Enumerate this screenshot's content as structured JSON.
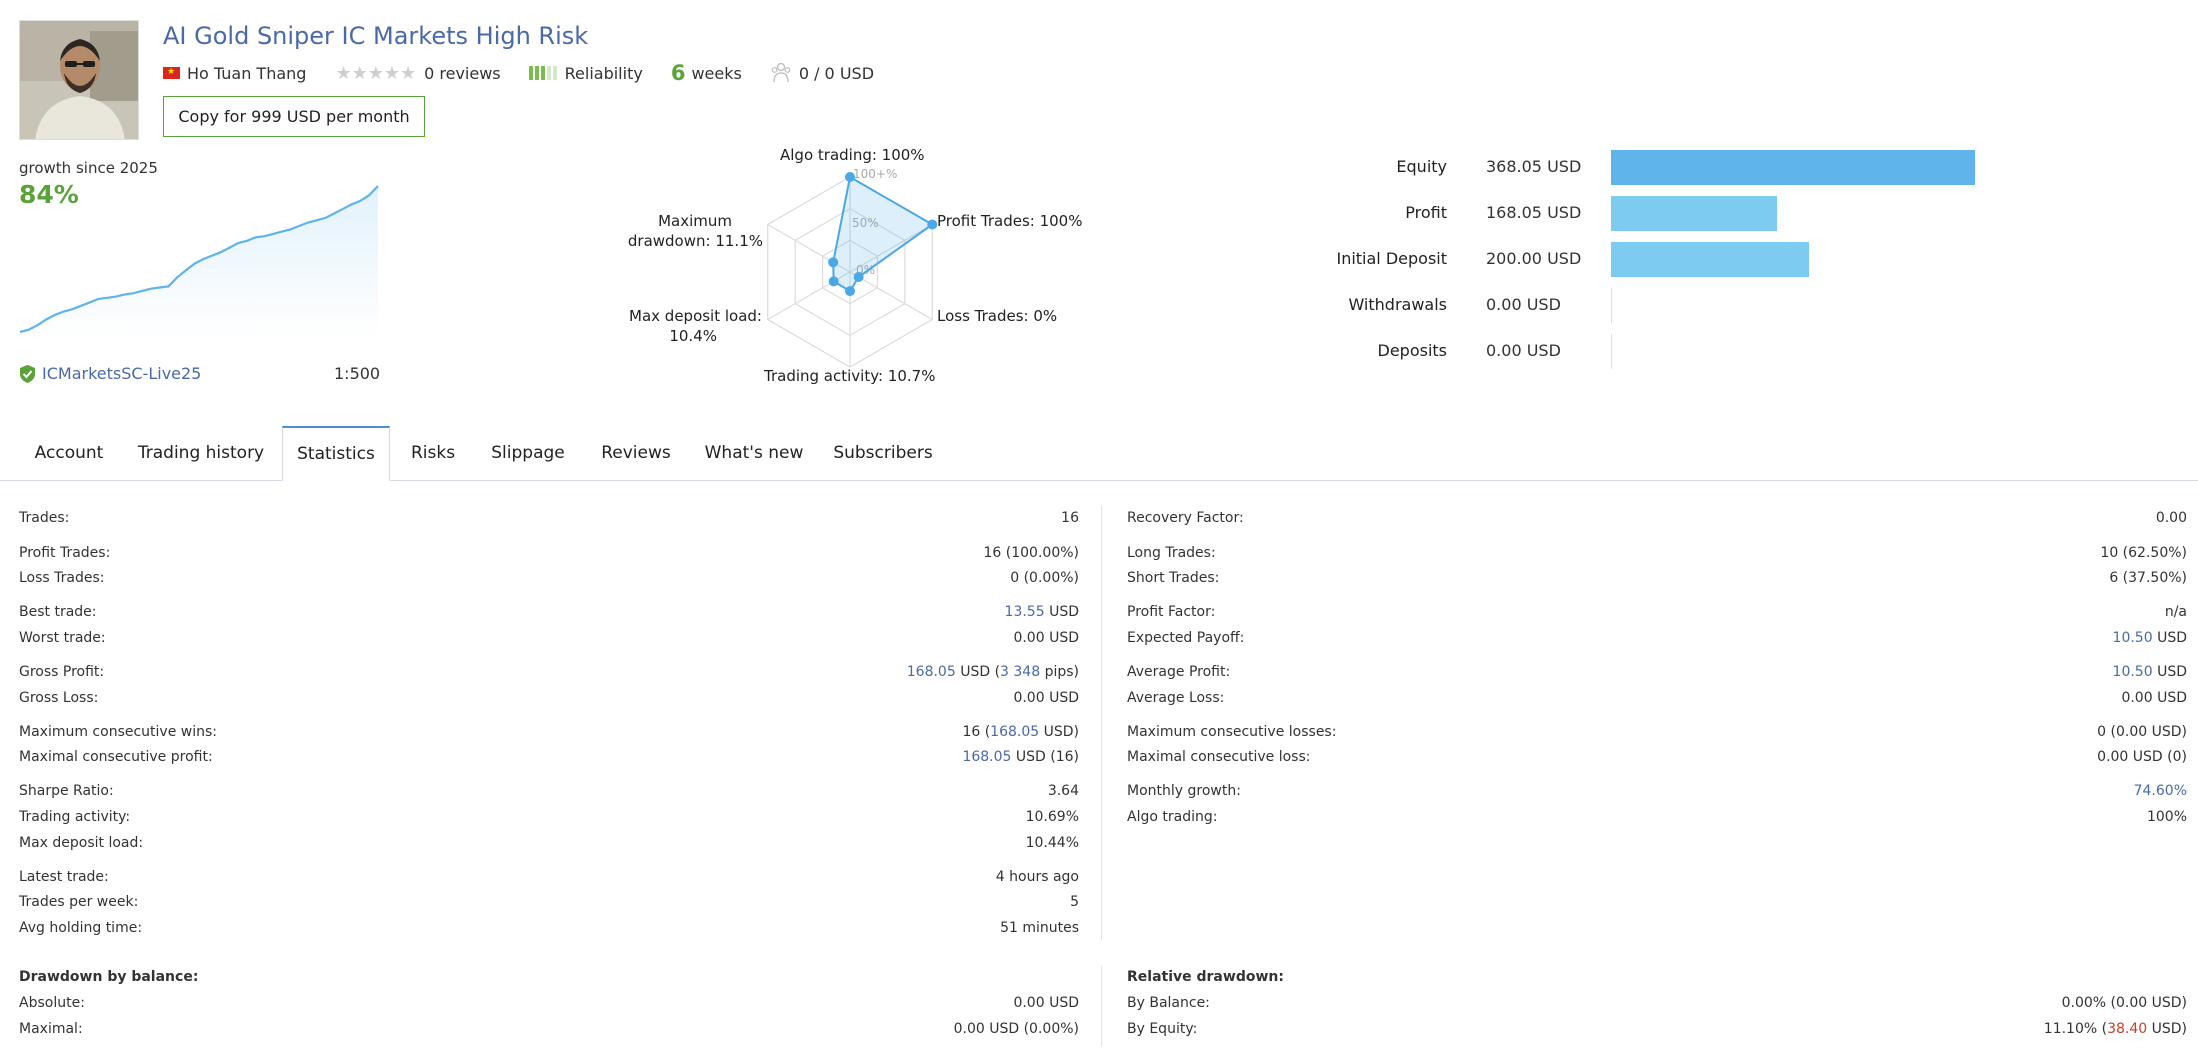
{
  "header": {
    "title": "AI Gold Sniper IC Markets High Risk",
    "author": "Ho Tuan Thang",
    "reviews": "0 reviews",
    "reliability": "Reliability",
    "weeks_num": "6",
    "weeks_unit": "weeks",
    "subscribers": "0 / 0 USD",
    "copy_button": "Copy for 999 USD per month",
    "reliability_level": 3
  },
  "growth": {
    "label": "growth since 2025",
    "value": "84%",
    "broker": "ICMarketsSC-Live25",
    "leverage": "1:500",
    "curve": [
      0,
      2,
      6,
      11,
      15,
      18,
      20,
      23,
      26,
      29,
      30,
      31,
      33,
      34,
      36,
      38,
      39,
      40,
      48,
      54,
      60,
      64,
      67,
      70,
      74,
      78,
      80,
      83,
      84,
      86,
      88,
      90,
      93,
      96,
      98,
      100,
      104,
      108,
      112,
      115,
      120,
      128
    ]
  },
  "radar": {
    "labels": {
      "algo": "Algo trading: 100%",
      "profit": "Profit Trades: 100%",
      "loss": "Loss Trades: 0%",
      "activity": "Trading activity: 10.7%",
      "load_1": "Max deposit load:",
      "load_2": "10.4%",
      "dd_1": "Maximum",
      "dd_2": "drawdown: 11.1%"
    },
    "scale": {
      "s100": "100+%",
      "s50": "50%",
      "s0": "0%"
    },
    "values": {
      "algo": 100,
      "profit": 100,
      "loss": 0,
      "activity": 10.7,
      "load": 10.4,
      "drawdown": 11.1
    }
  },
  "balance_bars": [
    {
      "label": "Equity",
      "value": "368.05 USD",
      "amount": 368.05,
      "color": "#5eb4eb"
    },
    {
      "label": "Profit",
      "value": "168.05 USD",
      "amount": 168.05,
      "color": "#7ecbf2"
    },
    {
      "label": "Initial Deposit",
      "value": "200.00 USD",
      "amount": 200.0,
      "color": "#7ecbf2"
    },
    {
      "label": "Withdrawals",
      "value": "0.00 USD",
      "amount": 0
    },
    {
      "label": "Deposits",
      "value": "0.00 USD",
      "amount": 0
    }
  ],
  "tabs": [
    "Account",
    "Trading history",
    "Statistics",
    "Risks",
    "Slippage",
    "Reviews",
    "What's new",
    "Subscribers"
  ],
  "active_tab": "Statistics",
  "stats_left": {
    "trades": {
      "label": "Trades:",
      "value": "16"
    },
    "profit_trades": {
      "label": "Profit Trades:",
      "value": "16 (100.00%)"
    },
    "loss_trades": {
      "label": "Loss Trades:",
      "value": "0 (0.00%)"
    },
    "best_trade": {
      "label": "Best trade:",
      "num": "13.55",
      "unit": " USD"
    },
    "worst_trade": {
      "label": "Worst trade:",
      "value": "0.00 USD"
    },
    "gross_profit": {
      "label": "Gross Profit:",
      "num": "168.05",
      "mid": " USD (",
      "pips": "3 348",
      "end": " pips)"
    },
    "gross_loss": {
      "label": "Gross Loss:",
      "value": "0.00 USD"
    },
    "max_consec_wins": {
      "label": "Maximum consecutive wins:",
      "pre": "16 (",
      "num": "168.05",
      "end": " USD)"
    },
    "max_consec_profit": {
      "label": "Maximal consecutive profit:",
      "num": "168.05",
      "end": " USD (16)"
    },
    "sharpe": {
      "label": "Sharpe Ratio:",
      "value": "3.64"
    },
    "activity": {
      "label": "Trading activity:",
      "value": "10.69%"
    },
    "max_load": {
      "label": "Max deposit load:",
      "value": "10.44%"
    },
    "latest_trade": {
      "label": "Latest trade:",
      "value": "4 hours ago"
    },
    "trades_week": {
      "label": "Trades per week:",
      "value": "5"
    },
    "avg_holding": {
      "label": "Avg holding time:",
      "value": "51 minutes"
    },
    "dd_balance_title": "Drawdown by balance:",
    "absolute": {
      "label": "Absolute:",
      "value": "0.00 USD"
    },
    "maximal": {
      "label": "Maximal:",
      "value": "0.00 USD (0.00%)"
    }
  },
  "stats_right": {
    "recovery": {
      "label": "Recovery Factor:",
      "value": "0.00"
    },
    "long_trades": {
      "label": "Long Trades:",
      "value": "10 (62.50%)"
    },
    "short_trades": {
      "label": "Short Trades:",
      "value": "6 (37.50%)"
    },
    "profit_factor": {
      "label": "Profit Factor:",
      "value": "n/a"
    },
    "expected_payoff": {
      "label": "Expected Payoff:",
      "num": "10.50",
      "unit": " USD"
    },
    "avg_profit": {
      "label": "Average Profit:",
      "num": "10.50",
      "unit": " USD"
    },
    "avg_loss": {
      "label": "Average Loss:",
      "value": "0.00 USD"
    },
    "max_consec_losses": {
      "label": "Maximum consecutive losses:",
      "value": "0 (0.00 USD)"
    },
    "max_consec_loss": {
      "label": "Maximal consecutive loss:",
      "value": "0.00 USD (0)"
    },
    "monthly_growth": {
      "label": "Monthly growth:",
      "value": "74.60%"
    },
    "algo_trading": {
      "label": "Algo trading:",
      "value": "100%"
    },
    "rel_dd_title": "Relative drawdown:",
    "by_balance": {
      "label": "By Balance:",
      "value": "0.00% (0.00 USD)"
    },
    "by_equity": {
      "label": "By Equity:",
      "pre": "11.10% (",
      "num": "38.40",
      "end": " USD)"
    }
  }
}
